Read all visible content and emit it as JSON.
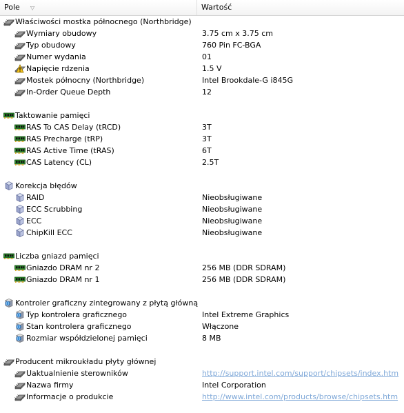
{
  "columns": {
    "field": "Pole",
    "value": "Wartość"
  },
  "sections": [
    {
      "title": "Właściwości mostka północnego (Northbridge)",
      "icon": "chip-icon",
      "items": [
        {
          "label": "Wymiary obudowy",
          "value": "3.75 cm x 3.75 cm",
          "icon": "chip-icon"
        },
        {
          "label": "Typ obudowy",
          "value": "760 Pin FC-BGA",
          "icon": "chip-icon"
        },
        {
          "label": "Numer wydania",
          "value": "01",
          "icon": "chip-icon"
        },
        {
          "label": "Napięcie rdzenia",
          "value": "1.5 V",
          "icon": "voltage-warning-icon"
        },
        {
          "label": "Mostek północny (Northbridge)",
          "value": "Intel Brookdale-G i845G",
          "icon": "chip-icon"
        },
        {
          "label": "In-Order Queue Depth",
          "value": "12",
          "icon": "chip-icon"
        }
      ]
    },
    {
      "title": "Taktowanie pamięci",
      "icon": "memory-module-icon",
      "items": [
        {
          "label": "RAS To CAS Delay (tRCD)",
          "value": "3T",
          "icon": "memory-module-icon"
        },
        {
          "label": "RAS Precharge (tRP)",
          "value": "3T",
          "icon": "memory-module-icon"
        },
        {
          "label": "RAS Active Time (tRAS)",
          "value": "6T",
          "icon": "memory-module-icon"
        },
        {
          "label": "CAS Latency (CL)",
          "value": "2.5T",
          "icon": "memory-module-icon"
        }
      ]
    },
    {
      "title": "Korekcja błędów",
      "icon": "cube-icon",
      "items": [
        {
          "label": "RAID",
          "value": "Nieobsługiwane",
          "icon": "cube-icon"
        },
        {
          "label": "ECC Scrubbing",
          "value": "Nieobsługiwane",
          "icon": "cube-icon"
        },
        {
          "label": "ECC",
          "value": "Nieobsługiwane",
          "icon": "cube-icon"
        },
        {
          "label": "ChipKill ECC",
          "value": "Nieobsługiwane",
          "icon": "cube-icon"
        }
      ]
    },
    {
      "title": "Liczba gniazd pamięci",
      "icon": "memory-module-icon",
      "items": [
        {
          "label": "Gniazdo DRAM nr 2",
          "value": "256 MB  (DDR SDRAM)",
          "icon": "memory-module-icon"
        },
        {
          "label": "Gniazdo DRAM nr 1",
          "value": "256 MB  (DDR SDRAM)",
          "icon": "memory-module-icon"
        }
      ]
    },
    {
      "title": "Kontroler graficzny zintegrowany z płytą główną",
      "icon": "display-adapter-icon",
      "items": [
        {
          "label": "Typ kontrolera graficznego",
          "value": "Intel Extreme Graphics",
          "icon": "display-adapter-icon"
        },
        {
          "label": "Stan kontrolera graficznego",
          "value": "Włączone",
          "icon": "display-adapter-icon"
        },
        {
          "label": "Rozmiar współdzielonej pamięci",
          "value": "8 MB",
          "icon": "display-adapter-icon"
        }
      ]
    },
    {
      "title": "Producent mikroukładu płyty głównej",
      "icon": "chip-icon",
      "items": [
        {
          "label": "Uaktualnienie sterowników",
          "value": "http://support.intel.com/support/chipsets/index.htm",
          "icon": "chip-icon",
          "link": true
        },
        {
          "label": "Nazwa firmy",
          "value": "Intel Corporation",
          "icon": "chip-icon"
        },
        {
          "label": "Informacje o produkcie",
          "value": "http://www.intel.com/products/browse/chipsets.htm",
          "icon": "chip-icon",
          "link": true
        }
      ]
    }
  ]
}
